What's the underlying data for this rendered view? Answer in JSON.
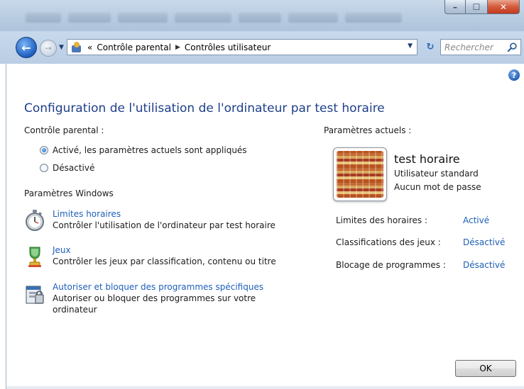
{
  "window": {
    "minimize_glyph": "–",
    "maximize_glyph": "☐",
    "close_glyph": "✕"
  },
  "nav": {
    "breadcrumb_prefix": "«",
    "breadcrumb": [
      "Contrôle parental",
      "Contrôles utilisateur"
    ],
    "search_placeholder": "Rechercher"
  },
  "page": {
    "title": "Configuration de l'utilisation de l'ordinateur par test horaire",
    "parental_control_label": "Contrôle parental :",
    "radio_on": "Activé, les paramètres actuels sont appliqués",
    "radio_off": "Désactivé",
    "windows_settings_label": "Paramètres Windows",
    "tasks": [
      {
        "link": "Limites horaires",
        "desc": "Contrôler l'utilisation de l'ordinateur par test horaire",
        "icon": "stopwatch-icon"
      },
      {
        "link": "Jeux",
        "desc": "Contrôler les jeux par classification, contenu ou titre",
        "icon": "trophy-icon"
      },
      {
        "link": "Autoriser et bloquer des programmes spécifiques",
        "desc": "Autoriser ou bloquer des programmes sur votre ordinateur",
        "icon": "program-block-icon"
      }
    ],
    "current_settings_label": "Paramètres actuels :",
    "user": {
      "name": "test horaire",
      "type": "Utilisateur standard",
      "password": "Aucun mot de passe"
    },
    "settings": [
      {
        "label": "Limites des horaires :",
        "value": "Activé"
      },
      {
        "label": "Classifications des jeux :",
        "value": "Désactivé"
      },
      {
        "label": "Blocage de programmes :",
        "value": "Désactivé"
      }
    ],
    "ok_label": "OK"
  },
  "colors": {
    "title": "#1e3f8a",
    "link": "#1d5fb8"
  }
}
